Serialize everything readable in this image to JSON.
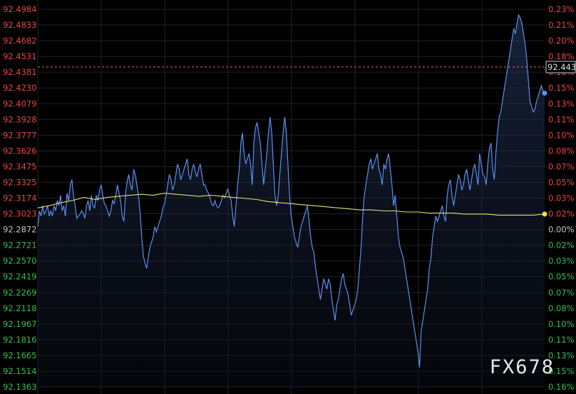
{
  "chart_data": {
    "type": "line",
    "title": "",
    "xlabel": "",
    "ylabel": "",
    "ylim": [
      92.1363,
      92.4984
    ],
    "left_ticks": [
      "92.4984",
      "92.4833",
      "92.4682",
      "92.4531",
      "92.4381",
      "92.4230",
      "92.4079",
      "92.3928",
      "92.3777",
      "92.3626",
      "92.3475",
      "92.3325",
      "92.3174",
      "92.3023",
      "92.2872",
      "92.2721",
      "92.2570",
      "92.2419",
      "92.2269",
      "92.2118",
      "92.1967",
      "92.1816",
      "92.1665",
      "92.1514",
      "92.1363"
    ],
    "right_ticks": [
      "0.23%",
      "0.21%",
      "0.20%",
      "0.18%",
      "0.16%",
      "0.15%",
      "0.13%",
      "0.11%",
      "0.10%",
      "0.08%",
      "0.07%",
      "0.05%",
      "0.03%",
      "0.02%",
      "0.00%",
      "0.02%",
      "0.03%",
      "0.05%",
      "0.07%",
      "0.08%",
      "0.10%",
      "0.11%",
      "0.13%",
      "0.15%",
      "0.16%"
    ],
    "reference_price": 92.2872,
    "current_price_label": "92.443",
    "current_price": 92.443,
    "series": [
      {
        "color": "#5b8ff0",
        "values": [
          92.29,
          92.305,
          92.3,
          92.31,
          92.302,
          92.305,
          92.31,
          92.3,
          92.305,
          92.3,
          92.31,
          92.305,
          92.315,
          92.31,
          92.32,
          92.305,
          92.31,
          92.3,
          92.322,
          92.315,
          92.33,
          92.335,
          92.32,
          92.31,
          92.298,
          92.3,
          92.302,
          92.305,
          92.303,
          92.298,
          92.31,
          92.315,
          92.305,
          92.32,
          92.31,
          92.308,
          92.32,
          92.315,
          92.325,
          92.33,
          92.32,
          92.312,
          92.31,
          92.305,
          92.3,
          92.305,
          92.315,
          92.312,
          92.32,
          92.33,
          92.322,
          92.315,
          92.3,
          92.295,
          92.322,
          92.333,
          92.34,
          92.33,
          92.325,
          92.345,
          92.34,
          92.33,
          92.32,
          92.303,
          92.28,
          92.262,
          92.255,
          92.25,
          92.26,
          92.27,
          92.275,
          92.28,
          92.29,
          92.285,
          92.29,
          92.295,
          92.3,
          92.308,
          92.312,
          92.32,
          92.33,
          92.34,
          92.335,
          92.325,
          92.33,
          92.34,
          92.35,
          92.345,
          92.335,
          92.34,
          92.345,
          92.35,
          92.355,
          92.34,
          92.335,
          92.345,
          92.35,
          92.342,
          92.338,
          92.345,
          92.35,
          92.34,
          92.33,
          92.33,
          92.325,
          92.322,
          92.318,
          92.312,
          92.31,
          92.315,
          92.31,
          92.308,
          92.31,
          92.315,
          92.32,
          92.318,
          92.322,
          92.326,
          92.32,
          92.315,
          92.3,
          92.29,
          92.31,
          92.33,
          92.345,
          92.37,
          92.38,
          92.36,
          92.35,
          92.355,
          92.36,
          92.35,
          92.33,
          92.37,
          92.385,
          92.39,
          92.38,
          92.37,
          92.35,
          92.33,
          92.345,
          92.36,
          92.38,
          92.395,
          92.38,
          92.35,
          92.32,
          92.31,
          92.32,
          92.34,
          92.36,
          92.38,
          92.395,
          92.38,
          92.35,
          92.32,
          92.3,
          92.29,
          92.28,
          92.275,
          92.27,
          92.28,
          92.29,
          92.295,
          92.3,
          92.305,
          92.31,
          92.295,
          92.28,
          92.27,
          92.265,
          92.25,
          92.24,
          92.23,
          92.22,
          92.23,
          92.24,
          92.235,
          92.23,
          92.24,
          92.235,
          92.22,
          92.21,
          92.2,
          92.215,
          92.22,
          92.23,
          92.24,
          92.245,
          92.235,
          92.23,
          92.225,
          92.215,
          92.205,
          92.21,
          92.215,
          92.22,
          92.23,
          92.25,
          92.27,
          92.3,
          92.32,
          92.33,
          92.34,
          92.35,
          92.355,
          92.345,
          92.35,
          92.355,
          92.36,
          92.345,
          92.34,
          92.33,
          92.35,
          92.345,
          92.355,
          92.36,
          92.345,
          92.33,
          92.31,
          92.32,
          92.3,
          92.28,
          92.27,
          92.265,
          92.26,
          92.25,
          92.24,
          92.23,
          92.22,
          92.21,
          92.2,
          92.19,
          92.18,
          92.17,
          92.155,
          92.19,
          92.2,
          92.21,
          92.22,
          92.23,
          92.25,
          92.26,
          92.28,
          92.29,
          92.3,
          92.295,
          92.3,
          92.305,
          92.31,
          92.3,
          92.295,
          92.32,
          92.33,
          92.335,
          92.32,
          92.31,
          92.32,
          92.33,
          92.34,
          92.335,
          92.325,
          92.33,
          92.34,
          92.345,
          92.335,
          92.325,
          92.335,
          92.345,
          92.35,
          92.34,
          92.33,
          92.36,
          92.35,
          92.34,
          92.338,
          92.33,
          92.35,
          92.365,
          92.37,
          92.345,
          92.335,
          92.36,
          92.38,
          92.395,
          92.4,
          92.41,
          92.42,
          92.43,
          92.44,
          92.45,
          92.46,
          92.47,
          92.48,
          92.475,
          92.485,
          92.493,
          92.49,
          92.485,
          92.475,
          92.465,
          92.45,
          92.43,
          92.41,
          92.405,
          92.4,
          92.402,
          92.41,
          92.415,
          92.42,
          92.425,
          92.42,
          92.418
        ]
      },
      {
        "color": "#e8e070",
        "values": [
          92.308,
          92.31,
          92.313,
          92.315,
          92.318,
          92.316,
          92.318,
          92.319,
          92.32,
          92.321,
          92.32,
          92.322,
          92.321,
          92.32,
          92.319,
          92.32,
          92.319,
          92.318,
          92.317,
          92.316,
          92.314,
          92.313,
          92.312,
          92.311,
          92.31,
          92.309,
          92.308,
          92.307,
          92.306,
          92.306,
          92.305,
          92.305,
          92.304,
          92.304,
          92.303,
          92.303,
          92.303,
          92.302,
          92.302,
          92.302,
          92.301,
          92.301,
          92.301,
          92.301,
          92.302
        ]
      }
    ]
  },
  "watermark": "FX678",
  "colors": {
    "up": "#e84545",
    "down": "#35c050",
    "neutral": "#c8c8c8",
    "line": "#5b8ff0",
    "avg": "#e8e070",
    "grid": "#1f2225",
    "ref": "#e06a6a"
  }
}
